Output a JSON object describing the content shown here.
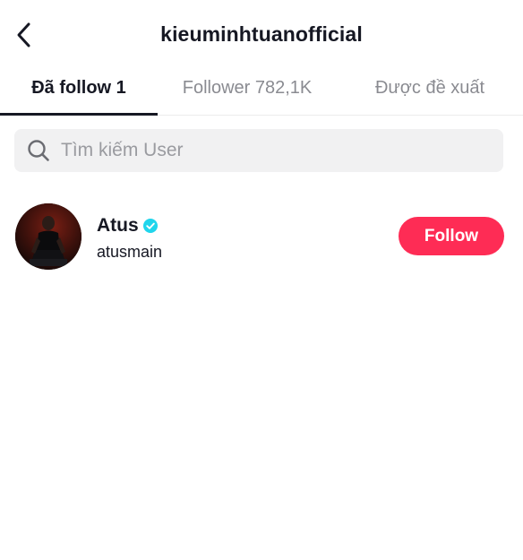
{
  "header": {
    "title": "kieuminhtuanofficial",
    "back_icon": "chevron-left-icon"
  },
  "tabs": [
    {
      "label": "Đã follow 1",
      "active": true
    },
    {
      "label": "Follower 782,1K",
      "active": false
    },
    {
      "label": "Được đề xuất",
      "active": false
    }
  ],
  "search": {
    "placeholder": "Tìm kiếm User",
    "value": "",
    "icon": "search-icon"
  },
  "users": [
    {
      "display_name": "Atus",
      "username": "atusmain",
      "verified": true,
      "follow_label": "Follow"
    }
  ],
  "colors": {
    "accent": "#fe2c55",
    "verified": "#20d5ec",
    "text_primary": "#161823",
    "text_secondary": "#8a8b91",
    "search_bg": "#f1f1f2"
  }
}
